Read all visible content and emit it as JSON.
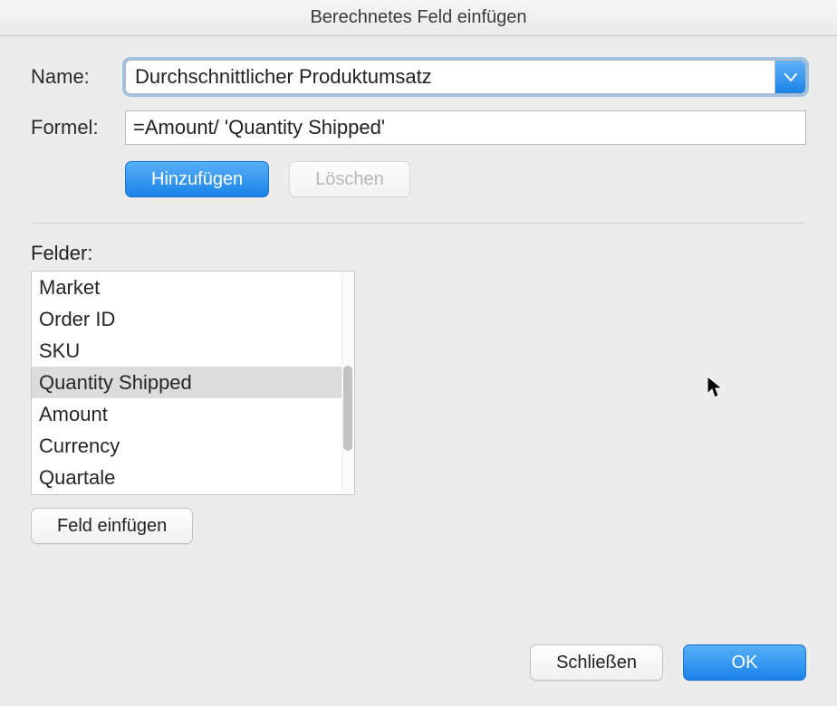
{
  "title": "Berechnetes Feld einfügen",
  "labels": {
    "name": "Name:",
    "formula": "Formel:",
    "fields": "Felder:"
  },
  "inputs": {
    "name_value": "Durchschnittlicher Produktumsatz",
    "formula_value": "=Amount/ 'Quantity Shipped'"
  },
  "buttons": {
    "add": "Hinzufügen",
    "delete": "Löschen",
    "insert_field": "Feld einfügen",
    "close": "Schließen",
    "ok": "OK"
  },
  "fields_list": [
    "Market",
    "Order ID",
    "SKU",
    "Quantity Shipped",
    "Amount",
    "Currency",
    "Quartale"
  ],
  "selected_field_index": 3
}
